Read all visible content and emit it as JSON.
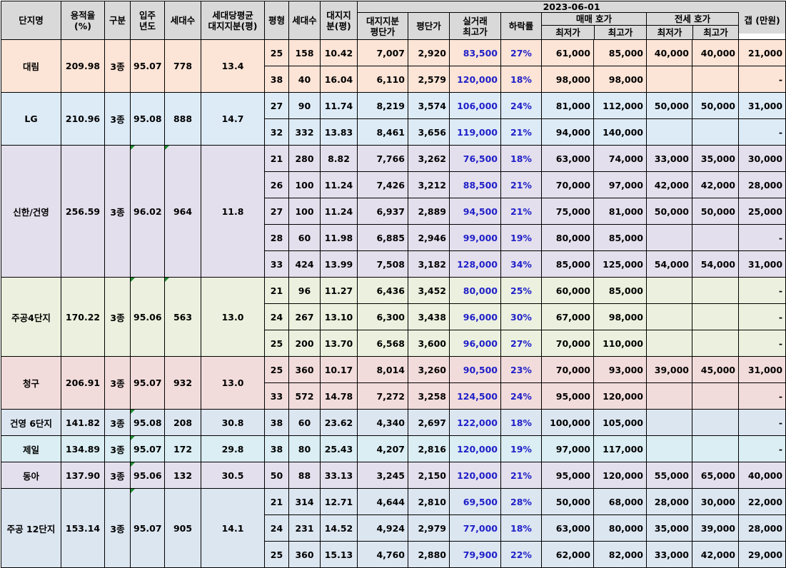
{
  "header": {
    "name": "단지명",
    "far": "용적율\n(%)",
    "zone": "구분",
    "move_in": "입주\n년도",
    "households": "세대수",
    "avg_land": "세대당평균\n대지지분(평)",
    "pyeong": "평형",
    "unit_households": "세대수",
    "land_share": "대지지\n분(평)",
    "date": "2023-06-01",
    "land_price": "대지지분\n평단가",
    "unit_price": "평단가",
    "real_max": "실거래\n최고가",
    "drop_rate": "하락률",
    "sale_group": "매매 호가",
    "jeonse_group": "전세 호가",
    "min": "최저가",
    "max": "최고가",
    "gap": "갭 (만원)"
  },
  "complexes": [
    {
      "key": "daerim",
      "name": "대림",
      "far": "209.98",
      "zone": "3종",
      "year": "95.07",
      "households": "778",
      "avg_land": "13.4",
      "units": [
        {
          "pyeong": "25",
          "hh": "158",
          "land": "10.42",
          "land_price": "7,007",
          "price": "2,920",
          "real_max": "83,500",
          "drop": "27%",
          "sale_min": "61,000",
          "sale_max": "85,000",
          "jeonse_min": "40,000",
          "jeonse_max": "40,000",
          "gap": "21,000"
        },
        {
          "pyeong": "38",
          "hh": "40",
          "land": "16.04",
          "land_price": "6,110",
          "price": "2,579",
          "real_max": "120,000",
          "drop": "18%",
          "sale_min": "98,000",
          "sale_max": "98,000",
          "jeonse_min": "",
          "jeonse_max": "",
          "gap": "-"
        }
      ]
    },
    {
      "key": "lg",
      "name": "LG",
      "far": "210.96",
      "zone": "3종",
      "year": "95.08",
      "households": "888",
      "avg_land": "14.7",
      "units": [
        {
          "pyeong": "27",
          "hh": "90",
          "land": "11.74",
          "land_price": "8,219",
          "price": "3,574",
          "real_max": "106,000",
          "drop": "24%",
          "sale_min": "81,000",
          "sale_max": "112,000",
          "jeonse_min": "50,000",
          "jeonse_max": "50,000",
          "gap": "31,000"
        },
        {
          "pyeong": "32",
          "hh": "332",
          "land": "13.83",
          "land_price": "8,461",
          "price": "3,656",
          "real_max": "119,000",
          "drop": "21%",
          "sale_min": "94,000",
          "sale_max": "140,000",
          "jeonse_min": "",
          "jeonse_max": "",
          "gap": "-"
        }
      ]
    },
    {
      "key": "shinhan",
      "name": "신한/건영",
      "far": "256.59",
      "zone": "3종",
      "year": "96.02",
      "households": "964",
      "avg_land": "11.8",
      "units": [
        {
          "pyeong": "21",
          "hh": "280",
          "land": "8.82",
          "land_price": "7,766",
          "price": "3,262",
          "real_max": "76,500",
          "drop": "18%",
          "sale_min": "63,000",
          "sale_max": "74,000",
          "jeonse_min": "33,000",
          "jeonse_max": "35,000",
          "gap": "30,000"
        },
        {
          "pyeong": "26",
          "hh": "100",
          "land": "11.24",
          "land_price": "7,426",
          "price": "3,212",
          "real_max": "88,500",
          "drop": "21%",
          "sale_min": "70,000",
          "sale_max": "97,000",
          "jeonse_min": "42,000",
          "jeonse_max": "42,000",
          "gap": "28,000"
        },
        {
          "pyeong": "27",
          "hh": "100",
          "land": "11.24",
          "land_price": "6,937",
          "price": "2,889",
          "real_max": "94,500",
          "drop": "21%",
          "sale_min": "75,000",
          "sale_max": "81,000",
          "jeonse_min": "50,000",
          "jeonse_max": "50,000",
          "gap": "25,000"
        },
        {
          "pyeong": "28",
          "hh": "60",
          "land": "11.98",
          "land_price": "6,885",
          "price": "2,946",
          "real_max": "99,000",
          "drop": "19%",
          "sale_min": "80,000",
          "sale_max": "85,000",
          "jeonse_min": "",
          "jeonse_max": "",
          "gap": "-"
        },
        {
          "pyeong": "33",
          "hh": "424",
          "land": "13.99",
          "land_price": "7,508",
          "price": "3,182",
          "real_max": "128,000",
          "drop": "34%",
          "sale_min": "85,000",
          "sale_max": "125,000",
          "jeonse_min": "54,000",
          "jeonse_max": "54,000",
          "gap": "31,000"
        }
      ]
    },
    {
      "key": "jugong4",
      "name": "주공4단지",
      "far": "170.22",
      "zone": "3종",
      "year": "95.06",
      "households": "563",
      "avg_land": "13.0",
      "units": [
        {
          "pyeong": "21",
          "hh": "96",
          "land": "11.27",
          "land_price": "6,436",
          "price": "3,452",
          "real_max": "80,000",
          "drop": "25%",
          "sale_min": "60,000",
          "sale_max": "85,000",
          "jeonse_min": "",
          "jeonse_max": "",
          "gap": "-"
        },
        {
          "pyeong": "24",
          "hh": "267",
          "land": "13.10",
          "land_price": "6,300",
          "price": "3,438",
          "real_max": "96,000",
          "drop": "30%",
          "sale_min": "67,000",
          "sale_max": "98,000",
          "jeonse_min": "",
          "jeonse_max": "",
          "gap": "-"
        },
        {
          "pyeong": "25",
          "hh": "200",
          "land": "13.70",
          "land_price": "6,568",
          "price": "3,600",
          "real_max": "96,000",
          "drop": "27%",
          "sale_min": "70,000",
          "sale_max": "110,000",
          "jeonse_min": "",
          "jeonse_max": "",
          "gap": "-"
        }
      ]
    },
    {
      "key": "cheonggu",
      "name": "청구",
      "far": "206.91",
      "zone": "3종",
      "year": "95.07",
      "households": "932",
      "avg_land": "13.0",
      "units": [
        {
          "pyeong": "25",
          "hh": "360",
          "land": "10.17",
          "land_price": "8,014",
          "price": "3,260",
          "real_max": "90,500",
          "drop": "23%",
          "sale_min": "70,000",
          "sale_max": "93,000",
          "jeonse_min": "39,000",
          "jeonse_max": "45,000",
          "gap": "31,000"
        },
        {
          "pyeong": "33",
          "hh": "572",
          "land": "14.78",
          "land_price": "7,272",
          "price": "3,258",
          "real_max": "124,500",
          "drop": "24%",
          "sale_min": "95,000",
          "sale_max": "120,000",
          "jeonse_min": "",
          "jeonse_max": "",
          "gap": "-"
        }
      ]
    },
    {
      "key": "geonyoung6",
      "name": "건영 6단지",
      "far": "141.82",
      "zone": "3종",
      "year": "95.08",
      "households": "208",
      "avg_land": "30.8",
      "units": [
        {
          "pyeong": "38",
          "hh": "60",
          "land": "23.62",
          "land_price": "4,340",
          "price": "2,697",
          "real_max": "122,000",
          "drop": "18%",
          "sale_min": "100,000",
          "sale_max": "105,000",
          "jeonse_min": "",
          "jeonse_max": "",
          "gap": "-"
        }
      ]
    },
    {
      "key": "jeil",
      "name": "제일",
      "far": "134.89",
      "zone": "3종",
      "year": "95.07",
      "households": "172",
      "avg_land": "29.8",
      "units": [
        {
          "pyeong": "38",
          "hh": "80",
          "land": "25.43",
          "land_price": "4,207",
          "price": "2,816",
          "real_max": "120,000",
          "drop": "19%",
          "sale_min": "97,000",
          "sale_max": "117,000",
          "jeonse_min": "",
          "jeonse_max": "",
          "gap": "-"
        }
      ]
    },
    {
      "key": "donga",
      "name": "동아",
      "far": "137.90",
      "zone": "3종",
      "year": "95.06",
      "households": "132",
      "avg_land": "30.5",
      "units": [
        {
          "pyeong": "50",
          "hh": "88",
          "land": "33.13",
          "land_price": "3,245",
          "price": "2,150",
          "real_max": "120,000",
          "drop": "21%",
          "sale_min": "95,000",
          "sale_max": "120,000",
          "jeonse_min": "55,000",
          "jeonse_max": "65,000",
          "gap": "40,000"
        }
      ]
    },
    {
      "key": "jugong12",
      "name": "주공 12단지",
      "far": "153.14",
      "zone": "3종",
      "year": "95.07",
      "households": "905",
      "avg_land": "14.1",
      "units": [
        {
          "pyeong": "21",
          "hh": "314",
          "land": "12.71",
          "land_price": "4,644",
          "price": "2,810",
          "real_max": "69,500",
          "drop": "28%",
          "sale_min": "50,000",
          "sale_max": "68,000",
          "jeonse_min": "28,000",
          "jeonse_max": "30,000",
          "gap": "22,000"
        },
        {
          "pyeong": "24",
          "hh": "231",
          "land": "14.52",
          "land_price": "4,924",
          "price": "2,979",
          "real_max": "77,000",
          "drop": "18%",
          "sale_min": "63,000",
          "sale_max": "80,000",
          "jeonse_min": "35,000",
          "jeonse_max": "39,000",
          "gap": "28,000"
        },
        {
          "pyeong": "25",
          "hh": "360",
          "land": "15.13",
          "land_price": "4,760",
          "price": "2,880",
          "real_max": "79,900",
          "drop": "22%",
          "sale_min": "62,000",
          "sale_max": "82,000",
          "jeonse_min": "33,000",
          "jeonse_max": "42,000",
          "gap": "29,000"
        }
      ]
    }
  ],
  "colors": {
    "header_bg": "#d9d9d9",
    "value_blue": "#1f1fc8",
    "comment_marker": "#1e8a2e"
  }
}
